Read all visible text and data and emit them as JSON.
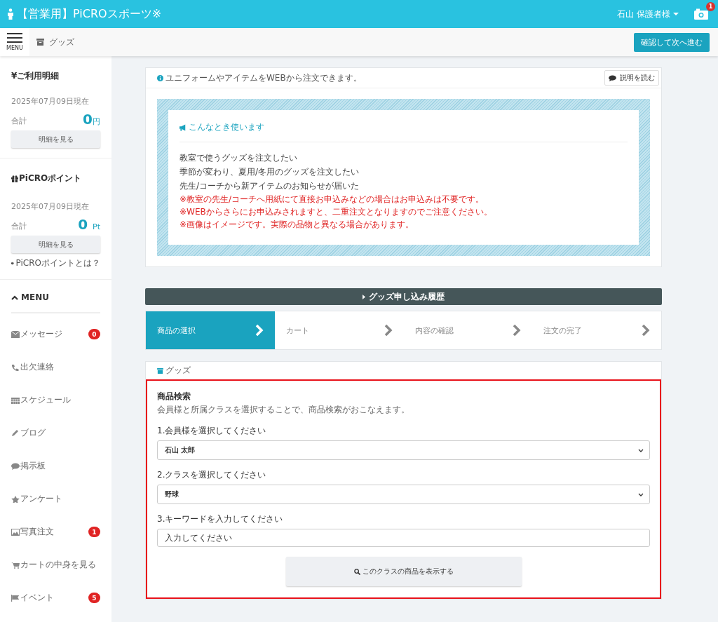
{
  "header": {
    "title": "【営業用】PiCROスポーツ※",
    "user": "石山 保護者様",
    "notification_count": "1"
  },
  "subbar": {
    "menu_label": "MENU",
    "breadcrumb": "グッズ",
    "next_button": "確認して次へ進む"
  },
  "sidebar": {
    "billing": {
      "title": "¥ご利用明細",
      "date": "2025年07月09日現在",
      "total_label": "合計",
      "amount": "0",
      "unit": "円",
      "button": "明細を見る"
    },
    "points": {
      "title": "PiCROポイント",
      "date": "2025年07月09日現在",
      "total_label": "合計",
      "amount": "0",
      "unit": "Pt",
      "button": "明細を見る",
      "help_link": "PiCROポイントとは？"
    },
    "menu_title": "MENU",
    "menu_items": [
      {
        "label": "メッセージ",
        "badge": "0"
      },
      {
        "label": "出欠連絡"
      },
      {
        "label": "スケジュール"
      },
      {
        "label": "ブログ"
      },
      {
        "label": "掲示板"
      },
      {
        "label": "アンケート"
      },
      {
        "label": "写真注文",
        "badge": "1"
      },
      {
        "label": "カートの中身を見る"
      },
      {
        "label": "イベント",
        "badge": "5"
      }
    ]
  },
  "info_card": {
    "header": "ユニフォームやアイテムをWEBから注文できます。",
    "read_button": "説明を読む",
    "usage_title": "こんなとき使います",
    "lines": [
      "教室で使うグッズを注文したい",
      "季節が変わり、夏用/冬用のグッズを注文したい",
      "先生/コーチから新アイテムのお知らせが届いた"
    ],
    "notes": [
      "※教室の先生/コーチへ用紙にて直接お申込みなどの場合はお申込みは不要です。",
      "※WEBからさらにお申込みされますと、二重注文となりますのでご注意ください。",
      "※画像はイメージです。実際の品物と異なる場合があります。"
    ]
  },
  "history_bar": "グッズ申し込み履歴",
  "steps": [
    {
      "label": "商品の選択",
      "selected": true
    },
    {
      "label": "カート",
      "selected": false
    },
    {
      "label": "内容の確認",
      "selected": false
    },
    {
      "label": "注文の完了",
      "selected": false
    }
  ],
  "goods": {
    "header": "グッズ",
    "search_title": "商品検索",
    "search_desc": "会員様と所属クラスを選択することで、商品検索がおこなえます。",
    "member_label": "1.会員様を選択してください",
    "member_value": "石山 太郎",
    "class_label": "2.クラスを選択してください",
    "class_value": "野球",
    "keyword_label": "3.キーワードを入力してください",
    "keyword_placeholder": "入力してください",
    "show_button": "このクラスの商品を表示する"
  }
}
